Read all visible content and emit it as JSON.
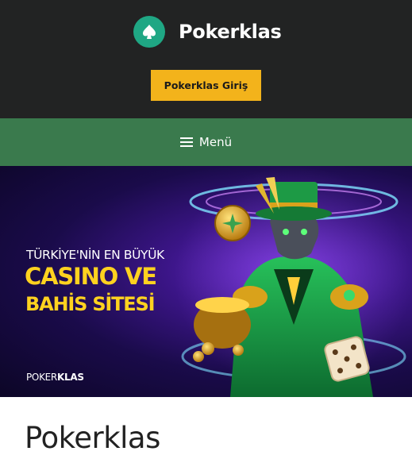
{
  "header": {
    "site_title": "Pokerklas",
    "logo_icon": "spade-icon",
    "login_button_label": "Pokerklas Giriş"
  },
  "nav": {
    "menu_label": "Menü",
    "menu_icon": "hamburger-icon"
  },
  "banner": {
    "line1": "TÜRKİYE'NİN EN BÜYÜK",
    "line2": "CASINO VE",
    "line3": "BAHİS SİTESİ",
    "logo_part1": "POKER",
    "logo_part2": "KLAS"
  },
  "main": {
    "page_title": "Pokerklas"
  },
  "colors": {
    "header_bg": "#222323",
    "nav_bg": "#3a7a4d",
    "button_bg": "#f3b31b",
    "logo_bg": "#1fa784",
    "banner_text_yellow": "#ffd21f"
  }
}
